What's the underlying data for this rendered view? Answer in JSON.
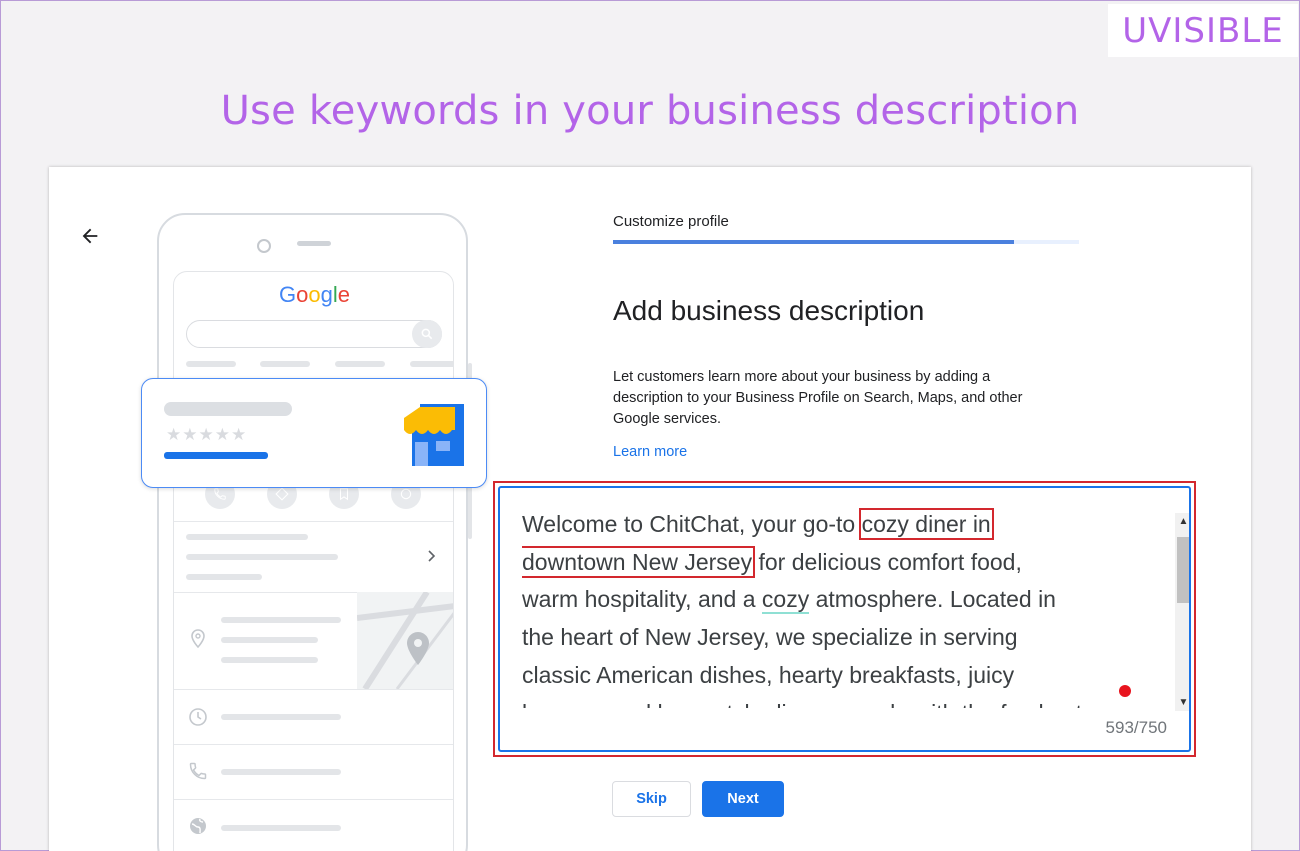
{
  "brand": {
    "logo_text": "UVISIBLE",
    "color": "#b364e8"
  },
  "headline": "Use keywords in your business description",
  "phone": {
    "google_logo": [
      {
        "ch": "G",
        "color": "#4285f4"
      },
      {
        "ch": "o",
        "color": "#ea4335"
      },
      {
        "ch": "o",
        "color": "#fbbc05"
      },
      {
        "ch": "g",
        "color": "#4285f4"
      },
      {
        "ch": "l",
        "color": "#34a853"
      },
      {
        "ch": "e",
        "color": "#ea4335"
      }
    ],
    "stars": "★★★★★",
    "storefront_colors": {
      "awning": "#fbbc05",
      "building": "#1a73e8"
    }
  },
  "step_label": "Customize profile",
  "progress": 0.86,
  "section_title": "Add business description",
  "description": "Let customers learn more about your business by adding a description to your Business Profile on Search, Maps, and other Google services.",
  "learn_more": "Learn more",
  "textarea": {
    "segments": [
      {
        "text": "Welcome to ChitChat, your go-to "
      },
      {
        "text": "cozy diner in",
        "keyword": true
      },
      {
        "text": "\n"
      },
      {
        "text": "downtown New Jersey",
        "keyword": true
      },
      {
        "text": " for delicious comfort food,\nwarm hospitality, and a "
      },
      {
        "text": "cozy",
        "spell": true
      },
      {
        "text": " atmosphere. Located in\nthe heart of New Jersey, we specialize in serving\nclassic American dishes, hearty breakfasts, juicy\nburgers, and homestyle dinners made with the freshest"
      }
    ],
    "counter": "593/750"
  },
  "buttons": {
    "skip": "Skip",
    "next": "Next"
  },
  "colors": {
    "accent": "#1a73e8",
    "highlight_box": "#d3282e"
  }
}
